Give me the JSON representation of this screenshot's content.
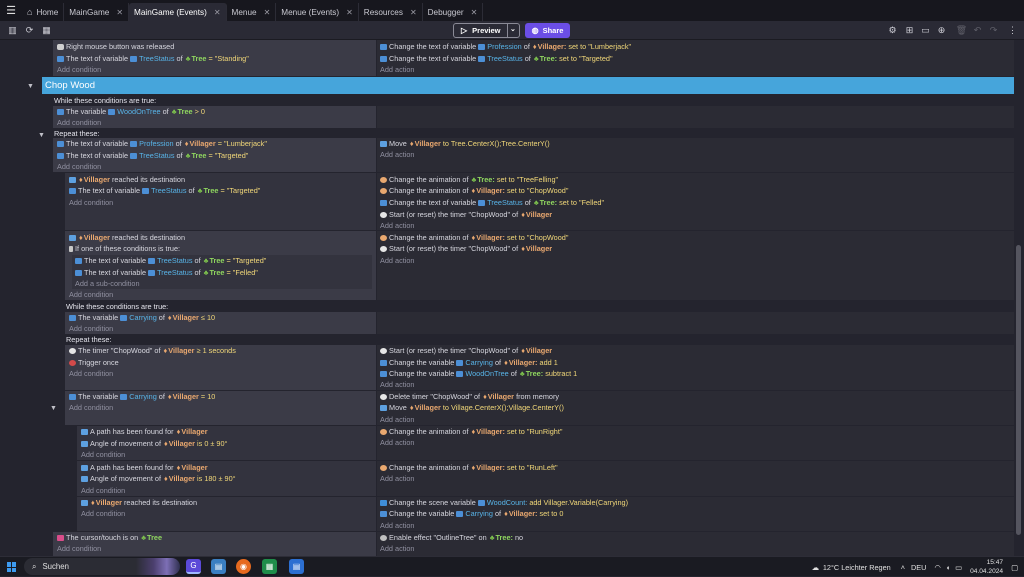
{
  "tabs": [
    {
      "label": "Home",
      "closable": false
    },
    {
      "label": "MainGame",
      "closable": true
    },
    {
      "label": "MainGame (Events)",
      "closable": true,
      "active": true
    },
    {
      "label": "Menue",
      "closable": true
    },
    {
      "label": "Menue (Events)",
      "closable": true
    },
    {
      "label": "Resources",
      "closable": true
    },
    {
      "label": "Debugger",
      "closable": true
    }
  ],
  "toolbar": {
    "preview_label": "Preview",
    "share_label": "Share"
  },
  "common": {
    "add_condition": "Add condition",
    "add_action": "Add action",
    "add_subcondition": "Add a sub-condition"
  },
  "events": {
    "e1": {
      "cond1": "Right mouse button was released",
      "cond2": {
        "pre": "The text of variable",
        "var": "TreeStatus",
        "of": "of",
        "obj": "Tree",
        "op": "= \"Standing\""
      },
      "act1": {
        "pre": "Change the text of variable",
        "var": "Profession",
        "of": "of",
        "obj": "Villager:",
        "rest": "set to \"Lumberjack\""
      },
      "act2": {
        "pre": "Change the text of variable",
        "var": "TreeStatus",
        "of": "of",
        "obj": "Tree:",
        "rest": "set to \"Targeted\""
      }
    },
    "group_title": "Chop Wood",
    "while1": {
      "header": "While these conditions are true:",
      "cond": {
        "pre": "The variable",
        "var": "WoodOnTree",
        "of": "of",
        "obj": "Tree",
        "op": "> 0"
      },
      "repeat": "Repeat these:"
    },
    "e2": {
      "cond1": {
        "pre": "The text of variable",
        "var": "Profession",
        "of": "of",
        "obj": "Villager",
        "op": "= \"Lumberjack\""
      },
      "cond2": {
        "pre": "The text of variable",
        "var": "TreeStatus",
        "of": "of",
        "obj": "Tree",
        "op": "= \"Targeted\""
      },
      "act1": {
        "pre": "Move",
        "obj": "Villager",
        "rest": "to Tree.CenterX();Tree.CenterY()"
      }
    },
    "e3": {
      "cond1": {
        "obj": "Villager",
        "rest": "reached its destination"
      },
      "cond2": {
        "pre": "The text of variable",
        "var": "TreeStatus",
        "of": "of",
        "obj": "Tree",
        "op": "= \"Targeted\""
      },
      "act1": {
        "pre": "Change the animation of",
        "obj": "Tree:",
        "rest": "set to \"TreeFelling\""
      },
      "act2": {
        "pre": "Change the animation of",
        "obj": "Villager:",
        "rest": "set to \"ChopWood\""
      },
      "act3": {
        "pre": "Change the text of variable",
        "var": "TreeStatus",
        "of": "of",
        "obj": "Tree:",
        "rest": "set to \"Felled\""
      },
      "act4": {
        "pre": "Start (or reset) the timer \"ChopWood\" of",
        "obj": "Villager"
      }
    },
    "e4": {
      "cond1": {
        "obj": "Villager",
        "rest": "reached its destination"
      },
      "cond2": "If one of these conditions is true:",
      "sub1": {
        "pre": "The text of variable",
        "var": "TreeStatus",
        "of": "of",
        "obj": "Tree",
        "op": "= \"Targeted\""
      },
      "sub2": {
        "pre": "The text of variable",
        "var": "TreeStatus",
        "of": "of",
        "obj": "Tree",
        "op": "= \"Felled\""
      },
      "act1": {
        "pre": "Change the animation of",
        "obj": "Villager:",
        "rest": "set to \"ChopWood\""
      },
      "act2": {
        "pre": "Start (or reset) the timer \"ChopWood\" of",
        "obj": "Villager"
      }
    },
    "while2": {
      "header": "While these conditions are true:",
      "cond": {
        "pre": "The variable",
        "var": "Carrying",
        "of": "of",
        "obj": "Villager",
        "op": "≤ 10"
      },
      "repeat": "Repeat these:"
    },
    "e5": {
      "cond1": {
        "pre": "The timer \"ChopWood\" of",
        "obj": "Villager",
        "op": "≥ 1 seconds"
      },
      "cond2": "Trigger once",
      "act1": {
        "pre": "Start (or reset) the timer \"ChopWood\" of",
        "obj": "Villager"
      },
      "act2": {
        "pre": "Change the variable",
        "var": "Carrying",
        "of": "of",
        "obj": "Villager:",
        "rest": "add 1"
      },
      "act3": {
        "pre": "Change the variable",
        "var": "WoodOnTree",
        "of": "of",
        "obj": "Tree:",
        "rest": "subtract 1"
      }
    },
    "e6": {
      "cond1": {
        "pre": "The variable",
        "var": "Carrying",
        "of": "of",
        "obj": "Villager",
        "op": "= 10"
      },
      "act1": {
        "pre": "Delete timer \"ChopWood\" of",
        "obj": "Villager",
        "rest": "from memory"
      },
      "act2": {
        "pre": "Move",
        "obj": "Villager",
        "rest": "to Village.CenterX();Village.CenterY()"
      }
    },
    "e7": {
      "cond1": {
        "pre": "A path has been found for",
        "obj": "Villager"
      },
      "cond2": {
        "pre": "Angle of movement of",
        "obj": "Villager",
        "op": "is 0 ± 90°"
      },
      "act1": {
        "pre": "Change the animation of",
        "obj": "Villager:",
        "rest": "set to \"RunRight\""
      }
    },
    "e8": {
      "cond1": {
        "pre": "A path has been found for",
        "obj": "Villager"
      },
      "cond2": {
        "pre": "Angle of movement of",
        "obj": "Villager",
        "op": "is 180 ± 90°"
      },
      "act1": {
        "pre": "Change the animation of",
        "obj": "Villager:",
        "rest": "set to \"RunLeft\""
      }
    },
    "e9": {
      "cond1": {
        "obj": "Villager",
        "rest": "reached its destination"
      },
      "act1": {
        "pre": "Change the scene variable",
        "var": "WoodCount:",
        "rest": "add Villager.Variable(Carrying)"
      },
      "act2": {
        "pre": "Change the variable",
        "var": "Carrying",
        "of": "of",
        "obj": "Villager:",
        "rest": "set to 0"
      }
    },
    "e10": {
      "cond1": {
        "pre": "The cursor/touch is on",
        "obj": "Tree"
      },
      "act1": {
        "pre": "Enable effect \"OutlineTree\" on",
        "obj": "Tree:",
        "rest": "no"
      }
    }
  },
  "taskbar": {
    "search_placeholder": "Suchen",
    "weather": "12°C  Leichter Regen",
    "lang": "DEU",
    "time": "15:47",
    "date": "04.04.2024"
  }
}
